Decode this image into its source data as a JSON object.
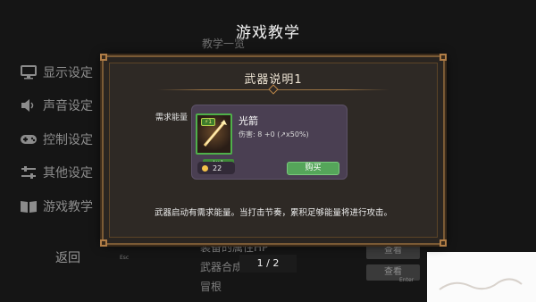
{
  "background": {
    "title": "游戏教学",
    "side_menu": [
      {
        "label": "显示设定",
        "icon": "monitor-icon"
      },
      {
        "label": "声音设定",
        "icon": "speaker-icon"
      },
      {
        "label": "控制设定",
        "icon": "gamepad-icon"
      },
      {
        "label": "其他设定",
        "icon": "sliders-icon"
      },
      {
        "label": "游戏教学",
        "icon": "book-icon"
      }
    ],
    "back_label": "返回",
    "esc_hint": "Esc",
    "top_item": "教学一览",
    "list_rows": [
      "装备的属性HP",
      "武器合成与徽章",
      "冒根"
    ],
    "view_label": "查看",
    "enter_hint": "Enter"
  },
  "modal": {
    "title": "武器说明1",
    "requirement_label": "需求能量",
    "weapon": {
      "energy_badge": "⚡1",
      "level": "Lv.1",
      "name": "光箭",
      "damage_text": "伤害: 8 +0 (↗x50%)",
      "cost": "22",
      "buy_label": "购买"
    },
    "description": "武器启动有需求能量。当打击节奏，累积足够能量将进行攻击。"
  },
  "pagination": {
    "text": "1 / 2"
  },
  "colors": {
    "frame": "#7a5a35",
    "card_bg": "#4a3f52",
    "buy_green": "#55a55a",
    "level_green": "#3f8a39"
  }
}
